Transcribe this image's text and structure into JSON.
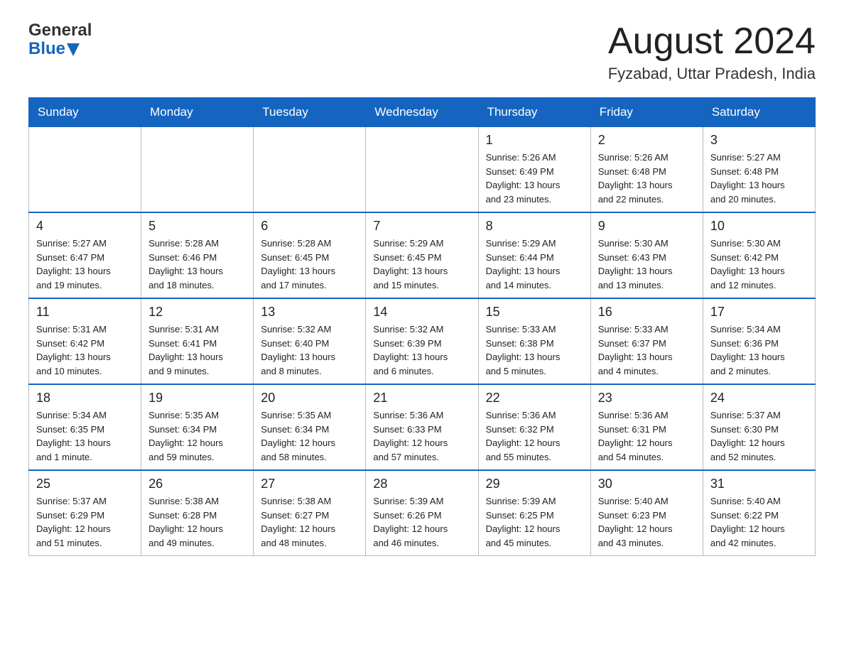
{
  "header": {
    "logo_general": "General",
    "logo_blue": "Blue",
    "month": "August 2024",
    "location": "Fyzabad, Uttar Pradesh, India"
  },
  "days_of_week": [
    "Sunday",
    "Monday",
    "Tuesday",
    "Wednesday",
    "Thursday",
    "Friday",
    "Saturday"
  ],
  "weeks": [
    [
      {
        "day": "",
        "info": ""
      },
      {
        "day": "",
        "info": ""
      },
      {
        "day": "",
        "info": ""
      },
      {
        "day": "",
        "info": ""
      },
      {
        "day": "1",
        "info": "Sunrise: 5:26 AM\nSunset: 6:49 PM\nDaylight: 13 hours\nand 23 minutes."
      },
      {
        "day": "2",
        "info": "Sunrise: 5:26 AM\nSunset: 6:48 PM\nDaylight: 13 hours\nand 22 minutes."
      },
      {
        "day": "3",
        "info": "Sunrise: 5:27 AM\nSunset: 6:48 PM\nDaylight: 13 hours\nand 20 minutes."
      }
    ],
    [
      {
        "day": "4",
        "info": "Sunrise: 5:27 AM\nSunset: 6:47 PM\nDaylight: 13 hours\nand 19 minutes."
      },
      {
        "day": "5",
        "info": "Sunrise: 5:28 AM\nSunset: 6:46 PM\nDaylight: 13 hours\nand 18 minutes."
      },
      {
        "day": "6",
        "info": "Sunrise: 5:28 AM\nSunset: 6:45 PM\nDaylight: 13 hours\nand 17 minutes."
      },
      {
        "day": "7",
        "info": "Sunrise: 5:29 AM\nSunset: 6:45 PM\nDaylight: 13 hours\nand 15 minutes."
      },
      {
        "day": "8",
        "info": "Sunrise: 5:29 AM\nSunset: 6:44 PM\nDaylight: 13 hours\nand 14 minutes."
      },
      {
        "day": "9",
        "info": "Sunrise: 5:30 AM\nSunset: 6:43 PM\nDaylight: 13 hours\nand 13 minutes."
      },
      {
        "day": "10",
        "info": "Sunrise: 5:30 AM\nSunset: 6:42 PM\nDaylight: 13 hours\nand 12 minutes."
      }
    ],
    [
      {
        "day": "11",
        "info": "Sunrise: 5:31 AM\nSunset: 6:42 PM\nDaylight: 13 hours\nand 10 minutes."
      },
      {
        "day": "12",
        "info": "Sunrise: 5:31 AM\nSunset: 6:41 PM\nDaylight: 13 hours\nand 9 minutes."
      },
      {
        "day": "13",
        "info": "Sunrise: 5:32 AM\nSunset: 6:40 PM\nDaylight: 13 hours\nand 8 minutes."
      },
      {
        "day": "14",
        "info": "Sunrise: 5:32 AM\nSunset: 6:39 PM\nDaylight: 13 hours\nand 6 minutes."
      },
      {
        "day": "15",
        "info": "Sunrise: 5:33 AM\nSunset: 6:38 PM\nDaylight: 13 hours\nand 5 minutes."
      },
      {
        "day": "16",
        "info": "Sunrise: 5:33 AM\nSunset: 6:37 PM\nDaylight: 13 hours\nand 4 minutes."
      },
      {
        "day": "17",
        "info": "Sunrise: 5:34 AM\nSunset: 6:36 PM\nDaylight: 13 hours\nand 2 minutes."
      }
    ],
    [
      {
        "day": "18",
        "info": "Sunrise: 5:34 AM\nSunset: 6:35 PM\nDaylight: 13 hours\nand 1 minute."
      },
      {
        "day": "19",
        "info": "Sunrise: 5:35 AM\nSunset: 6:34 PM\nDaylight: 12 hours\nand 59 minutes."
      },
      {
        "day": "20",
        "info": "Sunrise: 5:35 AM\nSunset: 6:34 PM\nDaylight: 12 hours\nand 58 minutes."
      },
      {
        "day": "21",
        "info": "Sunrise: 5:36 AM\nSunset: 6:33 PM\nDaylight: 12 hours\nand 57 minutes."
      },
      {
        "day": "22",
        "info": "Sunrise: 5:36 AM\nSunset: 6:32 PM\nDaylight: 12 hours\nand 55 minutes."
      },
      {
        "day": "23",
        "info": "Sunrise: 5:36 AM\nSunset: 6:31 PM\nDaylight: 12 hours\nand 54 minutes."
      },
      {
        "day": "24",
        "info": "Sunrise: 5:37 AM\nSunset: 6:30 PM\nDaylight: 12 hours\nand 52 minutes."
      }
    ],
    [
      {
        "day": "25",
        "info": "Sunrise: 5:37 AM\nSunset: 6:29 PM\nDaylight: 12 hours\nand 51 minutes."
      },
      {
        "day": "26",
        "info": "Sunrise: 5:38 AM\nSunset: 6:28 PM\nDaylight: 12 hours\nand 49 minutes."
      },
      {
        "day": "27",
        "info": "Sunrise: 5:38 AM\nSunset: 6:27 PM\nDaylight: 12 hours\nand 48 minutes."
      },
      {
        "day": "28",
        "info": "Sunrise: 5:39 AM\nSunset: 6:26 PM\nDaylight: 12 hours\nand 46 minutes."
      },
      {
        "day": "29",
        "info": "Sunrise: 5:39 AM\nSunset: 6:25 PM\nDaylight: 12 hours\nand 45 minutes."
      },
      {
        "day": "30",
        "info": "Sunrise: 5:40 AM\nSunset: 6:23 PM\nDaylight: 12 hours\nand 43 minutes."
      },
      {
        "day": "31",
        "info": "Sunrise: 5:40 AM\nSunset: 6:22 PM\nDaylight: 12 hours\nand 42 minutes."
      }
    ]
  ]
}
